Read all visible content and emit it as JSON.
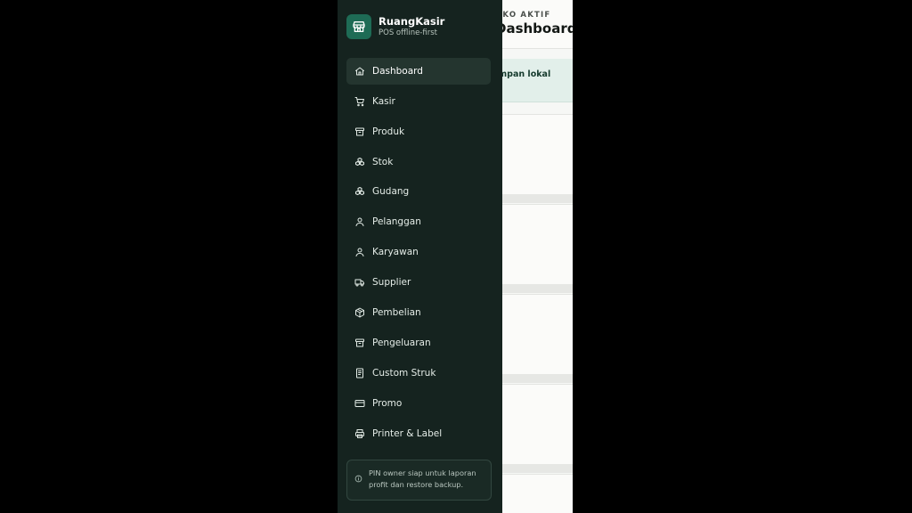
{
  "brand": {
    "name": "RuangKasir",
    "subtitle": "POS offline-first",
    "logo_icon": "store-icon",
    "accent": "#1e6b55"
  },
  "sidebar": {
    "items": [
      {
        "label": "Dashboard",
        "icon": "home-icon",
        "active": true
      },
      {
        "label": "Kasir",
        "icon": "cart-icon"
      },
      {
        "label": "Produk",
        "icon": "archive-box-icon"
      },
      {
        "label": "Stok",
        "icon": "boxes-icon"
      },
      {
        "label": "Gudang",
        "icon": "boxes-icon"
      },
      {
        "label": "Pelanggan",
        "icon": "user-icon"
      },
      {
        "label": "Karyawan",
        "icon": "user-icon"
      },
      {
        "label": "Supplier",
        "icon": "truck-icon"
      },
      {
        "label": "Pembelian",
        "icon": "package-icon"
      },
      {
        "label": "Pengeluaran",
        "icon": "archive-box-icon"
      },
      {
        "label": "Custom Struk",
        "icon": "receipt-icon"
      },
      {
        "label": "Promo",
        "icon": "card-icon"
      },
      {
        "label": "Printer & Label",
        "icon": "printer-icon"
      }
    ],
    "notice": {
      "icon": "info-icon",
      "text": "PIN owner siap untuk laporan profit dan restore backup."
    },
    "background": "#15231f"
  },
  "page": {
    "eyebrow": "OKO AKTIF",
    "title": "Dashboard",
    "banner_text": "impan lokal"
  }
}
